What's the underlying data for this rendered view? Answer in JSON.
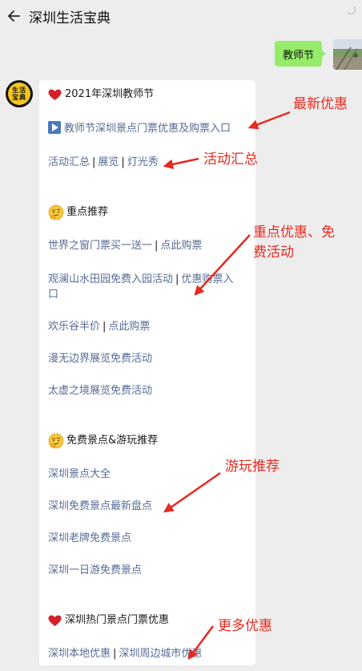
{
  "header": {
    "title": "深圳生活宝典"
  },
  "outgoing": {
    "message": "教师节"
  },
  "bot": {
    "avatar_text": "生活宝典"
  },
  "card": {
    "section1_title": "2021年深圳教师节",
    "section1_link": "教师节深圳景点门票优惠及购票入口",
    "section1_links": [
      "活动汇总",
      "展览",
      "灯光秀"
    ],
    "section2_title": "重点推荐",
    "section2_rows": [
      {
        "a": "世界之窗门票买一送一",
        "b": "点此购票"
      },
      {
        "a": "观澜山水田园免费入园活动",
        "b": "优惠购票入",
        "c": "口"
      },
      {
        "a": "欢乐谷半价",
        "b": "点此购票"
      }
    ],
    "section2_single": [
      "漫无边界展览免费活动",
      "太虚之境展览免费活动"
    ],
    "section3_title": "免费景点&游玩推荐",
    "section3_links": [
      "深圳景点大全",
      "深圳免费景点最新盘点",
      "深圳老牌免费景点",
      "深圳一日游免费景点"
    ],
    "section4_title": "深圳热门景点门票优惠",
    "section4_links": [
      "深圳本地优惠",
      "深圳周边城市优惠"
    ],
    "separator": "|"
  },
  "annotations": {
    "latest": "最新优惠",
    "summary": "活动汇总",
    "key_line1": "重点优惠、免",
    "key_line2": "费活动",
    "play": "游玩推荐",
    "more": "更多优惠"
  },
  "colors": {
    "link": "#576b95",
    "bubble": "#95ec69",
    "annotation": "#e52a20",
    "background": "#ededed"
  }
}
